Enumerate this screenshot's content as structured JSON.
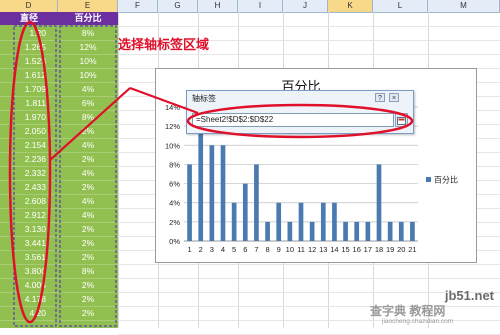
{
  "columns": [
    "D",
    "E",
    "F",
    "G",
    "H",
    "I",
    "J",
    "K",
    "L",
    "M"
  ],
  "selected_columns": [
    "D",
    "E",
    "K"
  ],
  "table": {
    "header_d": "直径",
    "header_e": "百分比",
    "diameters": [
      "1.20",
      "1.265",
      "1.523",
      "1.612",
      "1.709",
      "1.811",
      "1.970",
      "2.050",
      "2.154",
      "2.236",
      "2.332",
      "2.433",
      "2.608",
      "2.912",
      "3.130",
      "3.441",
      "3.561",
      "3.800",
      "4.005",
      "4.178",
      "4.20"
    ],
    "percents": [
      "8%",
      "12%",
      "10%",
      "10%",
      "4%",
      "6%",
      "8%",
      "2%",
      "4%",
      "2%",
      "4%",
      "2%",
      "4%",
      "4%",
      "2%",
      "2%",
      "2%",
      "8%",
      "2%",
      "2%",
      "2%"
    ]
  },
  "annotation": {
    "label": "选择轴标签区域",
    "color": "#e0102a"
  },
  "dialog": {
    "title": "轴标签",
    "range_value": "=Sheet2!$D$2:$D$22",
    "help_label": "?",
    "close_label": "×"
  },
  "chart_data": {
    "type": "bar",
    "title": "百分比",
    "categories": [
      "1",
      "2",
      "3",
      "4",
      "5",
      "6",
      "7",
      "8",
      "9",
      "10",
      "11",
      "12",
      "13",
      "14",
      "15",
      "16",
      "17",
      "18",
      "19",
      "20",
      "21"
    ],
    "series": [
      {
        "name": "百分比",
        "values": [
          8,
          12,
          10,
          10,
          4,
          6,
          8,
          2,
          4,
          2,
          4,
          2,
          4,
          4,
          2,
          2,
          2,
          8,
          2,
          2,
          2
        ]
      }
    ],
    "y_ticks": [
      "0%",
      "2%",
      "4%",
      "6%",
      "8%",
      "10%",
      "12%",
      "14%"
    ],
    "ylim": [
      0,
      14
    ],
    "bar_color": "#4a7ab0",
    "legend_position": "right",
    "grid": true
  },
  "watermark": {
    "site": "jb51.net",
    "name": "查字典 教程网",
    "url": "jiaocheng.chazidian.com"
  },
  "colors": {
    "data_fill": "#92c050",
    "header_fill": "#6b2fa0",
    "dash_border": "#5b3fb0",
    "ellipse": "#e0102a"
  }
}
